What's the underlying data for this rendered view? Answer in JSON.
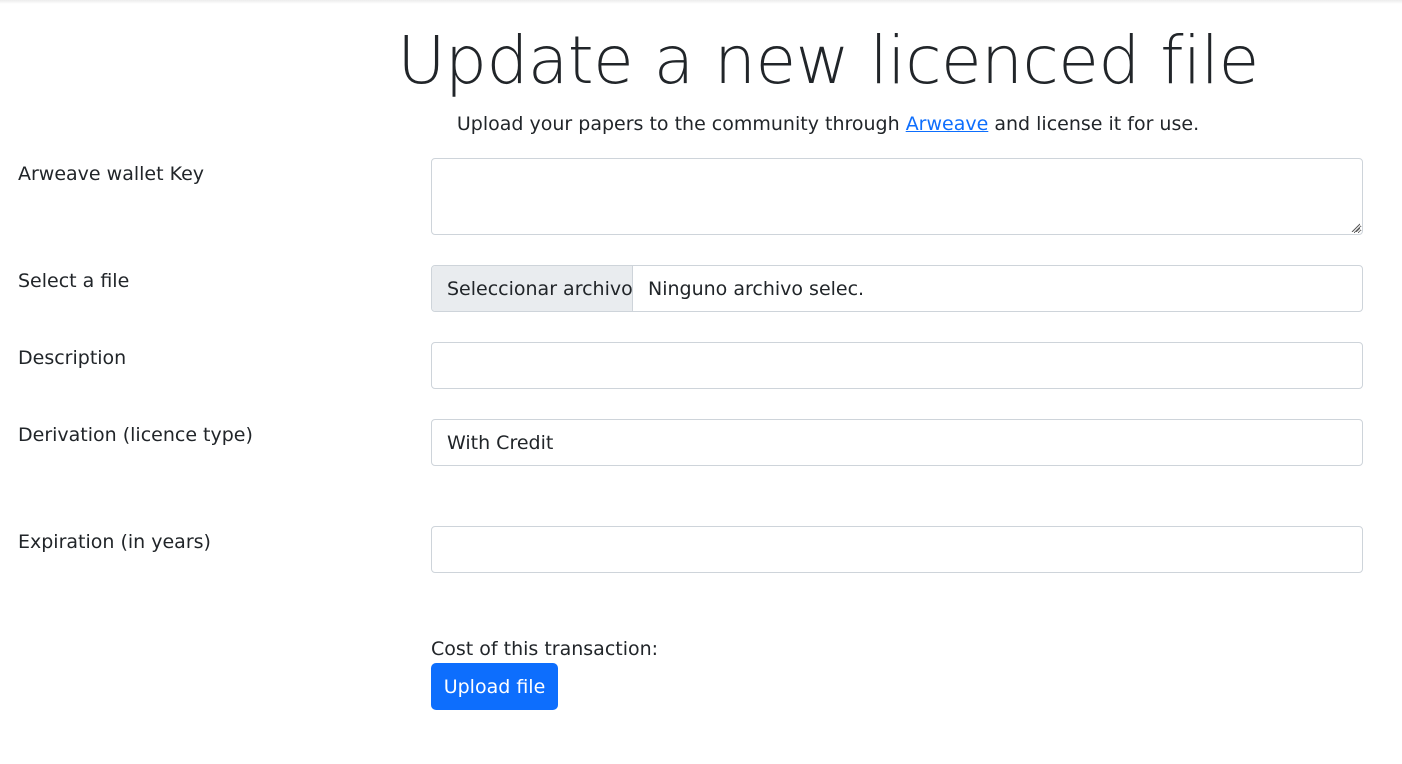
{
  "header": {
    "title": "Update a new licenced file",
    "lead_before": "Upload your papers to the community through ",
    "lead_link": "Arweave",
    "lead_after": " and license it for use."
  },
  "form": {
    "wallet_key": {
      "label": "Arweave wallet Key",
      "value": ""
    },
    "file": {
      "label": "Select a file",
      "button_label": "Seleccionar archivo",
      "status": "Ninguno archivo selec."
    },
    "description": {
      "label": "Description",
      "value": ""
    },
    "derivation": {
      "label": "Derivation (licence type)",
      "selected": "With Credit"
    },
    "expiration": {
      "label": "Expiration (in years)",
      "value": ""
    },
    "cost_label": "Cost of this transaction:",
    "submit_label": "Upload file"
  },
  "colors": {
    "primary": "#0d6efd",
    "text": "#212529",
    "border": "#ced4da",
    "file_button_bg": "#e9ecef"
  }
}
